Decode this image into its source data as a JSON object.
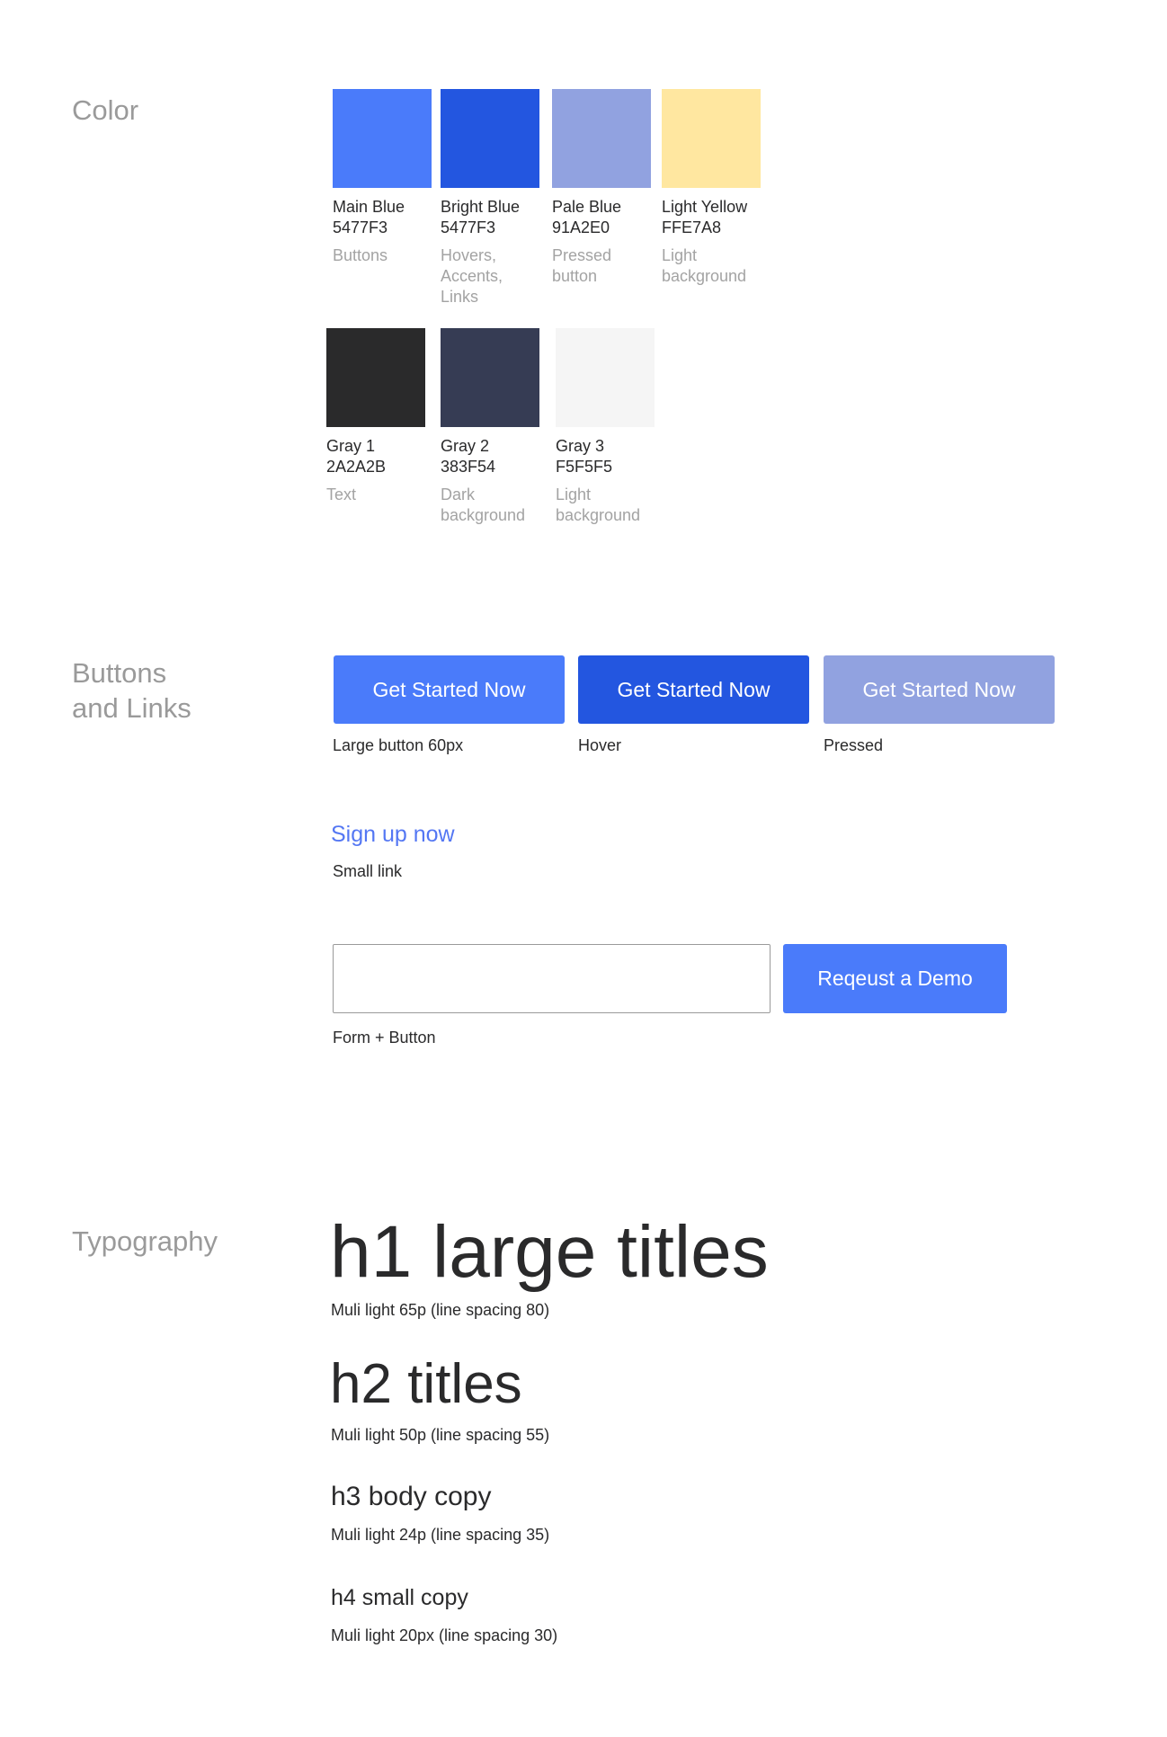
{
  "sections": {
    "color": "Color",
    "buttons": "Buttons\nand Links",
    "typography": "Typography"
  },
  "colors": {
    "main_blue": {
      "name": "Main Blue",
      "hex": "5477F3",
      "usage": "Buttons",
      "swatch": "#4A7BFA"
    },
    "bright_blue": {
      "name": "Bright Blue",
      "hex": "5477F3",
      "usage": "Hovers,\nAccents,\nLinks",
      "swatch": "#2356E0"
    },
    "pale_blue": {
      "name": "Pale Blue",
      "hex": "91A2E0",
      "usage": "Pressed\nbutton",
      "swatch": "#91A2E0"
    },
    "light_yellow": {
      "name": "Light Yellow",
      "hex": "FFE7A8",
      "usage": "Light\nbackground",
      "swatch": "#FFE7A0"
    },
    "gray1": {
      "name": "Gray 1",
      "hex": "2A2A2B",
      "usage": "Text",
      "swatch": "#2A2A2B"
    },
    "gray2": {
      "name": "Gray 2",
      "hex": "383F54",
      "usage": "Dark\nbackground",
      "swatch": "#363C54"
    },
    "gray3": {
      "name": "Gray 3",
      "hex": "F5F5F5",
      "usage": "Light\nbackground",
      "swatch": "#F5F5F5"
    }
  },
  "buttons": {
    "large": {
      "label": "Get Started Now",
      "caption": "Large button 60px",
      "color": "#4A7BFA"
    },
    "hover": {
      "label": "Get Started Now",
      "caption": "Hover",
      "color": "#2356E0"
    },
    "pressed": {
      "label": "Get Started Now",
      "caption": "Pressed",
      "color": "#91A2E0"
    }
  },
  "link": {
    "label": "Sign up now",
    "caption": "Small link"
  },
  "form": {
    "input_value": "",
    "button_label": "Reqeust a Demo",
    "caption": "Form + Button"
  },
  "typography": {
    "h1": {
      "sample": "h1 large titles",
      "spec": "Muli light 65p (line spacing 80)"
    },
    "h2": {
      "sample": "h2 titles",
      "spec": "Muli light 50p (line spacing 55)"
    },
    "h3": {
      "sample": "h3 body copy",
      "spec": "Muli light 24p (line spacing 35)"
    },
    "h4": {
      "sample": "h4 small copy",
      "spec": "Muli light 20px (line spacing 30)"
    }
  }
}
